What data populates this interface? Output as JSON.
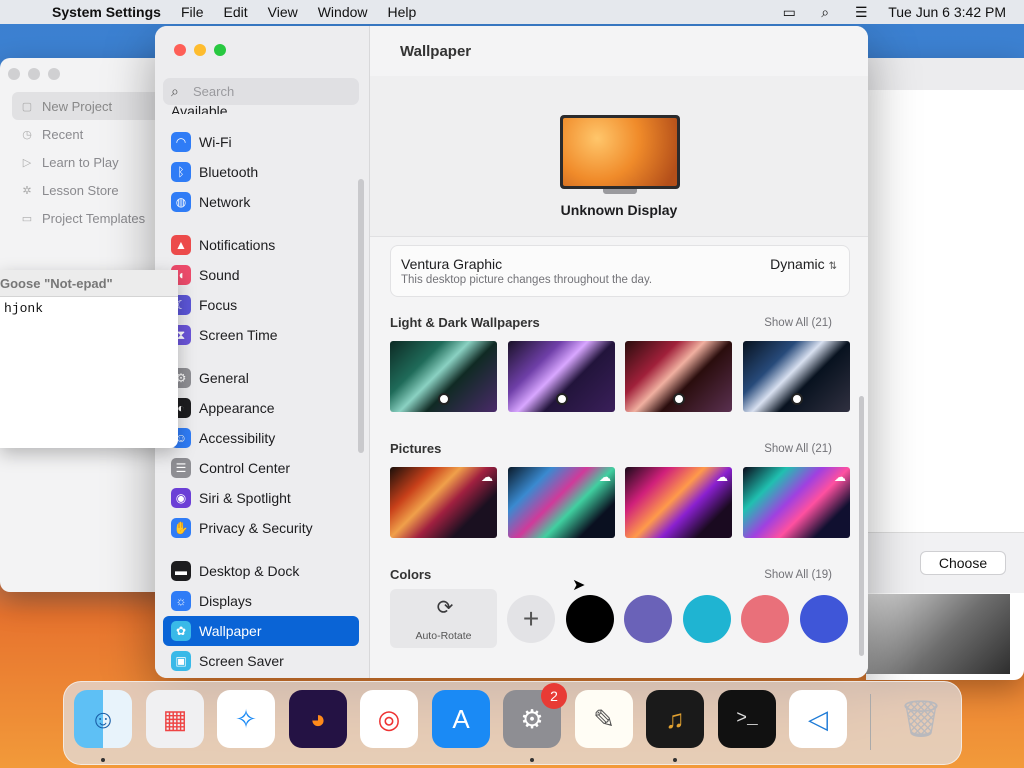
{
  "menubar": {
    "app_name": "System Settings",
    "menus": [
      "File",
      "Edit",
      "View",
      "Window",
      "Help"
    ],
    "datetime": "Tue Jun 6  3:42 PM"
  },
  "background_window": {
    "nav": [
      {
        "label": "New Project",
        "icon": "square-icon",
        "selected": true
      },
      {
        "label": "Recent",
        "icon": "clock-icon"
      },
      {
        "label": "Learn to Play",
        "icon": "play-icon"
      },
      {
        "label": "Lesson Store",
        "icon": "star-icon"
      },
      {
        "label": "Project Templates",
        "icon": "folder-icon"
      }
    ],
    "choose_label": "Choose"
  },
  "notepad": {
    "title": "Goose \"Not-epad\"",
    "text": "hjonk"
  },
  "sidebar": {
    "search_placeholder": "Search",
    "partial_item": "Available",
    "groups": [
      [
        {
          "label": "Wi-Fi",
          "icon": "wifi-icon",
          "color": "#2f7cf6"
        },
        {
          "label": "Bluetooth",
          "icon": "bluetooth-icon",
          "color": "#2f7cf6"
        },
        {
          "label": "Network",
          "icon": "globe-icon",
          "color": "#2f7cf6"
        }
      ],
      [
        {
          "label": "Notifications",
          "icon": "bell-icon",
          "color": "#ec4b4b"
        },
        {
          "label": "Sound",
          "icon": "speaker-icon",
          "color": "#ec4b6b"
        },
        {
          "label": "Focus",
          "icon": "moon-icon",
          "color": "#5b55d6"
        },
        {
          "label": "Screen Time",
          "icon": "hourglass-icon",
          "color": "#6a54d8"
        }
      ],
      [
        {
          "label": "General",
          "icon": "gear-icon",
          "color": "#8e8e93"
        },
        {
          "label": "Appearance",
          "icon": "appearance-icon",
          "color": "#1d1d1f"
        },
        {
          "label": "Accessibility",
          "icon": "accessibility-icon",
          "color": "#2f7cf6"
        },
        {
          "label": "Control Center",
          "icon": "control-center-icon",
          "color": "#8e8e93"
        },
        {
          "label": "Siri & Spotlight",
          "icon": "siri-icon",
          "color": "#6b3fd6"
        },
        {
          "label": "Privacy & Security",
          "icon": "hand-icon",
          "color": "#2f7cf6"
        }
      ],
      [
        {
          "label": "Desktop & Dock",
          "icon": "dock-icon",
          "color": "#1d1d1f"
        },
        {
          "label": "Displays",
          "icon": "display-icon",
          "color": "#2f7cf6"
        },
        {
          "label": "Wallpaper",
          "icon": "wallpaper-icon",
          "color": "#39b9e8",
          "selected": true
        },
        {
          "label": "Screen Saver",
          "icon": "screensaver-icon",
          "color": "#39b9e8"
        }
      ]
    ]
  },
  "content": {
    "title": "Wallpaper",
    "display_name": "Unknown Display",
    "current": {
      "name": "Ventura Graphic",
      "description": "This desktop picture changes throughout the day.",
      "mode": "Dynamic"
    },
    "sections": {
      "light_dark": {
        "title": "Light & Dark Wallpapers",
        "show_all": "Show All (21)"
      },
      "pictures": {
        "title": "Pictures",
        "show_all": "Show All (21)"
      },
      "colors": {
        "title": "Colors",
        "show_all": "Show All (19)"
      }
    },
    "auto_rotate_label": "Auto-Rotate",
    "color_swatches": [
      "#000000",
      "#6a62b8",
      "#1fb4d2",
      "#e9707a",
      "#3f56d8"
    ]
  },
  "dock": {
    "apps": [
      {
        "name": "Finder",
        "icon": "finder-icon",
        "running": true
      },
      {
        "name": "Launchpad",
        "icon": "launchpad-icon"
      },
      {
        "name": "Safari",
        "icon": "safari-icon"
      },
      {
        "name": "Firefox",
        "icon": "firefox-icon"
      },
      {
        "name": "Chrome",
        "icon": "chrome-icon"
      },
      {
        "name": "App Store",
        "icon": "app-store-icon"
      },
      {
        "name": "System Settings",
        "icon": "system-settings-icon",
        "running": true,
        "badge": "2"
      },
      {
        "name": "TextEdit",
        "icon": "textedit-icon"
      },
      {
        "name": "GarageBand",
        "icon": "garageband-icon",
        "running": true
      },
      {
        "name": "Terminal",
        "icon": "terminal-icon"
      },
      {
        "name": "Visual Studio Code",
        "icon": "vscode-icon"
      },
      {
        "name": "Trash",
        "icon": "trash-icon"
      }
    ]
  }
}
